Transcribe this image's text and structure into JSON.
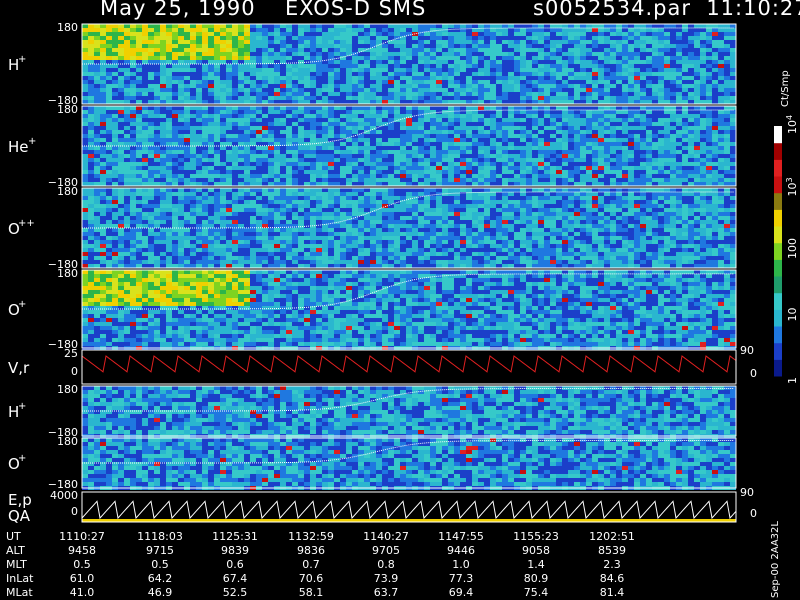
{
  "header": {
    "left": "May 25, 1990",
    "mid": "EXOS-D SMS",
    "right": "s0052534.par  11:10:27"
  },
  "panels": [
    {
      "name": "H",
      "sup": "+",
      "y_top": "180",
      "y_bottom": "−180",
      "kind": "angle"
    },
    {
      "name": "He",
      "sup": "+",
      "y_top": "180",
      "y_bottom": "−180",
      "kind": "angle"
    },
    {
      "name": "O",
      "sup": "++",
      "y_top": "180",
      "y_bottom": "−180",
      "kind": "angle"
    },
    {
      "name": "O",
      "sup": "+",
      "y_top": "180",
      "y_bottom": "−180",
      "kind": "angle"
    },
    {
      "name": "V,r",
      "sup": "",
      "y_top": "25",
      "y_mid": "0",
      "right_top": "90",
      "right_mid": "0",
      "kind": "line"
    },
    {
      "name": "H",
      "sup": "+",
      "y_top": "180",
      "y_bottom": "−180",
      "kind": "angle"
    },
    {
      "name": "O",
      "sup": "+",
      "y_top": "180",
      "y_bottom": "−180",
      "kind": "angle"
    },
    {
      "name": "E,p",
      "name2": "QA",
      "sup": "",
      "y_top": "4000",
      "y_mid": "0",
      "right_top": "90",
      "right_mid": "0",
      "kind": "qa"
    }
  ],
  "colorbar": {
    "unit": "Ct/Smp",
    "labels": [
      {
        "text": "10",
        "sup": "4",
        "level": 1.0
      },
      {
        "text": "10",
        "sup": "3",
        "level": 0.75
      },
      {
        "text": "100",
        "sup": "",
        "level": 0.5
      },
      {
        "text": "10",
        "sup": "",
        "level": 0.25
      },
      {
        "text": "1",
        "sup": "",
        "level": 0.0
      }
    ],
    "colors": [
      "#0a1a8c",
      "#1b3fc9",
      "#1f78e0",
      "#2ab6cf",
      "#36c9c9",
      "#1f9c6b",
      "#2db54a",
      "#7ed321",
      "#d9e21c",
      "#f0d000",
      "#8a7a10",
      "#c81010",
      "#e02020",
      "#a00000",
      "#ffffff"
    ]
  },
  "table": {
    "labels": [
      "UT",
      "ALT",
      "MLT",
      "InLat",
      "MLat"
    ],
    "rows": [
      [
        "1110:27",
        "1118:03",
        "1125:31",
        "1132:59",
        "1140:27",
        "1147:55",
        "1155:23",
        "1202:51"
      ],
      [
        "9458",
        "9715",
        "9839",
        "9836",
        "9705",
        "9446",
        "9058",
        "8539"
      ],
      [
        "0.5",
        "0.5",
        "0.6",
        "0.7",
        "0.8",
        "1.0",
        "1.4",
        "2.3"
      ],
      [
        "61.0",
        "64.2",
        "67.4",
        "70.6",
        "73.9",
        "77.3",
        "80.9",
        "84.6"
      ],
      [
        "41.0",
        "46.9",
        "52.5",
        "58.1",
        "63.7",
        "69.4",
        "75.4",
        "81.4"
      ]
    ]
  },
  "datestamp": "Sep-00 2AA32L"
}
